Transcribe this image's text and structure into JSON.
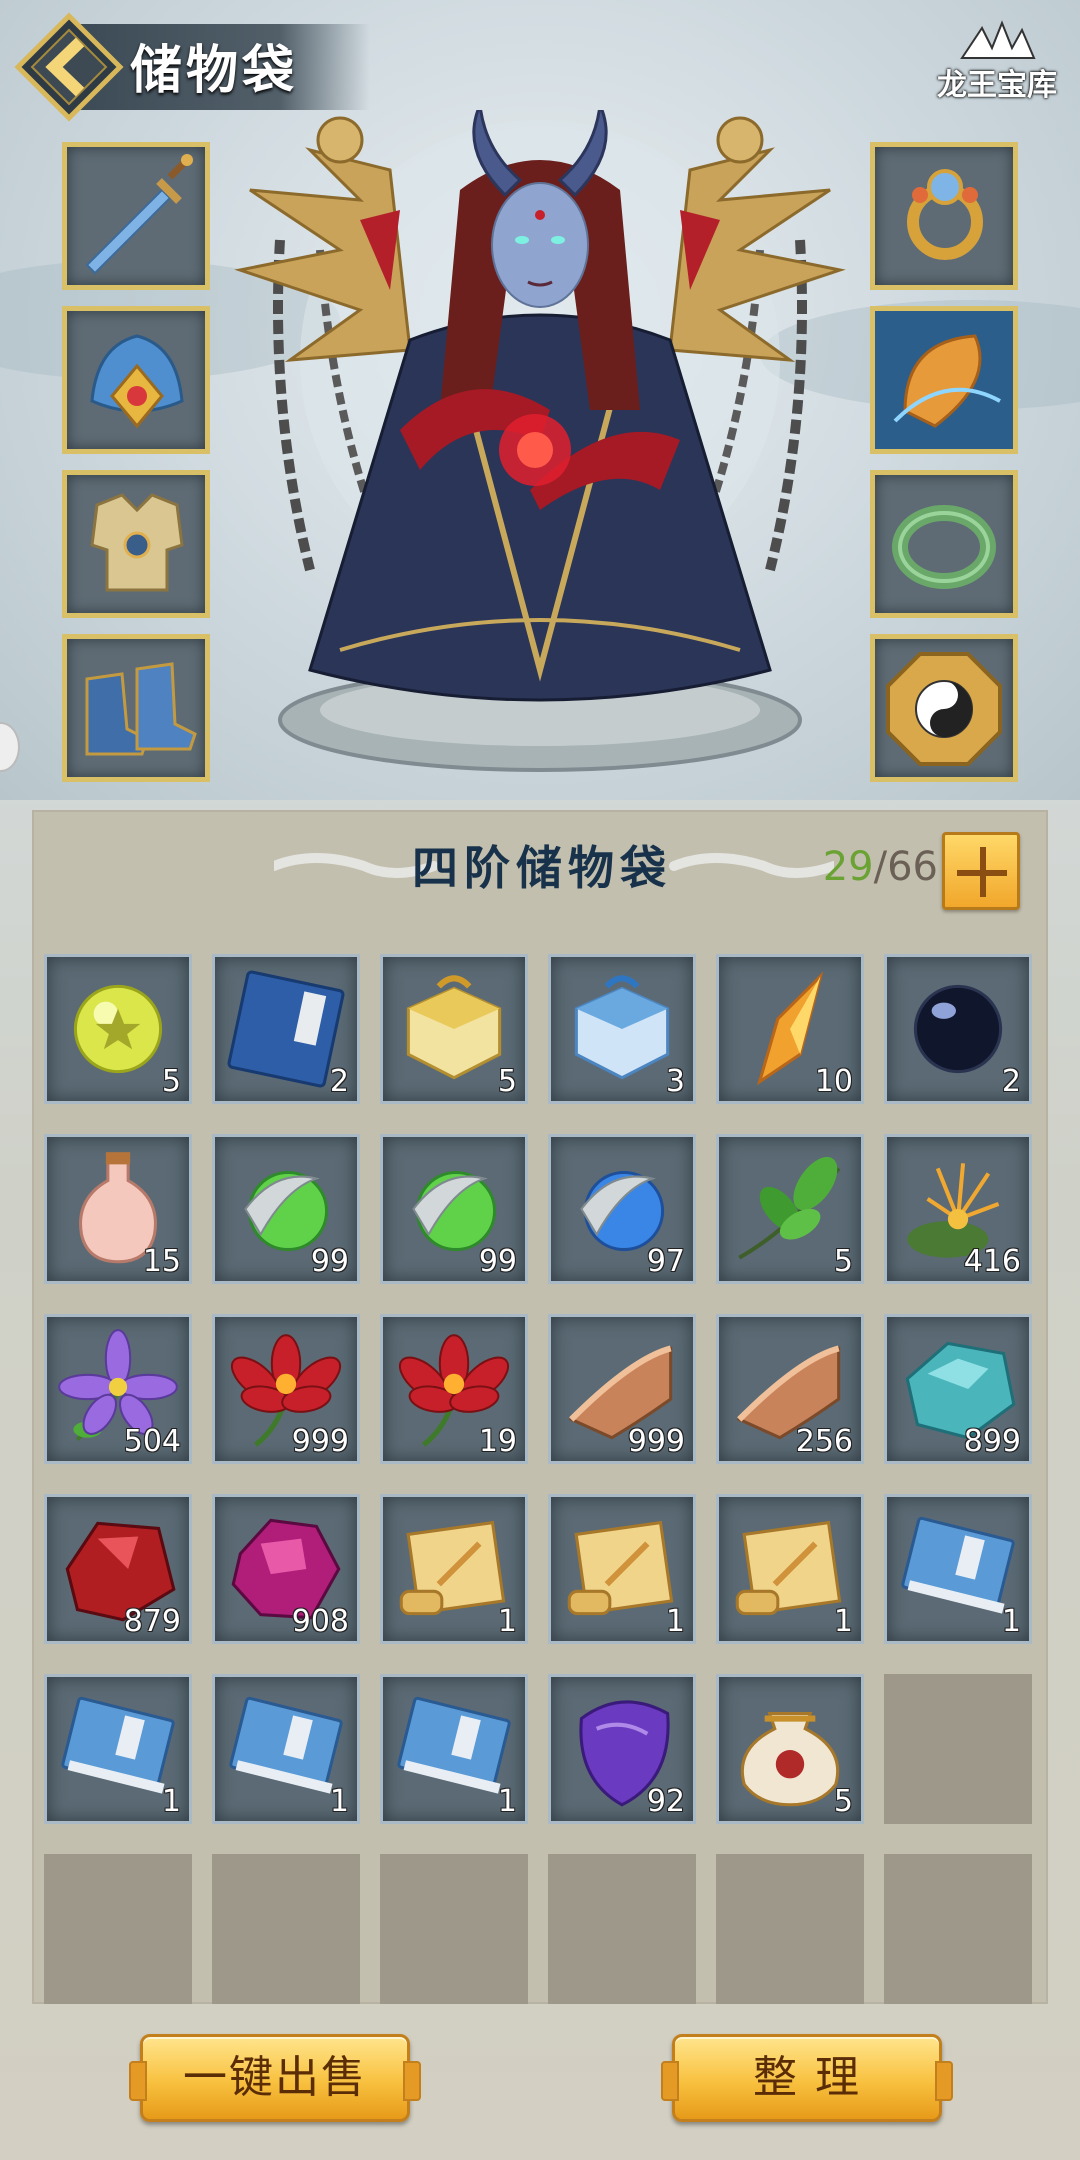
{
  "header": {
    "title": "储物袋",
    "logo_text": "龙王宝库"
  },
  "equipment": {
    "left": [
      "sword-icon",
      "crown-icon",
      "armor-icon",
      "boots-icon"
    ],
    "right": [
      "ring-icon",
      "amulet-icon",
      "jade-bracelet-icon",
      "bagua-mirror-icon"
    ]
  },
  "bag": {
    "title": "四阶储物袋",
    "used": "29",
    "separator": "/",
    "total": "66",
    "items": [
      {
        "icon": "star-orb-icon",
        "qty": "5"
      },
      {
        "icon": "manual-book-icon",
        "qty": "2"
      },
      {
        "icon": "gold-gift-box-icon",
        "qty": "5"
      },
      {
        "icon": "blue-gift-box-icon",
        "qty": "3"
      },
      {
        "icon": "orange-crystal-icon",
        "qty": "10"
      },
      {
        "icon": "black-pearl-icon",
        "qty": "2"
      },
      {
        "icon": "potion-bottle-icon",
        "qty": "15"
      },
      {
        "icon": "green-spirit-orb-icon",
        "qty": "99"
      },
      {
        "icon": "green-spirit-orb-icon",
        "qty": "99"
      },
      {
        "icon": "blue-spirit-orb-icon",
        "qty": "97"
      },
      {
        "icon": "herb-leaves-icon",
        "qty": "5"
      },
      {
        "icon": "spider-lily-icon",
        "qty": "416"
      },
      {
        "icon": "purple-flower-icon",
        "qty": "504"
      },
      {
        "icon": "red-lotus-icon",
        "qty": "999"
      },
      {
        "icon": "red-lotus-icon",
        "qty": "19"
      },
      {
        "icon": "copper-ingot-icon",
        "qty": "999"
      },
      {
        "icon": "copper-ingot-icon",
        "qty": "256"
      },
      {
        "icon": "cyan-stone-icon",
        "qty": "899"
      },
      {
        "icon": "red-crystal-icon",
        "qty": "879"
      },
      {
        "icon": "purple-gem-icon",
        "qty": "908"
      },
      {
        "icon": "scroll-icon",
        "qty": "1"
      },
      {
        "icon": "scroll-icon",
        "qty": "1"
      },
      {
        "icon": "scroll-icon",
        "qty": "1"
      },
      {
        "icon": "blue-book-icon",
        "qty": "1"
      },
      {
        "icon": "blue-book-icon",
        "qty": "1"
      },
      {
        "icon": "blue-book-icon",
        "qty": "1"
      },
      {
        "icon": "blue-book-icon",
        "qty": "1"
      },
      {
        "icon": "violet-stone-icon",
        "qty": "92"
      },
      {
        "icon": "money-pouch-icon",
        "qty": "5"
      }
    ],
    "empty_slots": 7
  },
  "buttons": {
    "sell_all": "一键出售",
    "organize": "整 理"
  },
  "colors": {
    "slot_border_gold": "#d9c067",
    "slot_bg": "#5b6a74",
    "used_count": "#6aa234",
    "button_gold": "#f8c13f"
  }
}
